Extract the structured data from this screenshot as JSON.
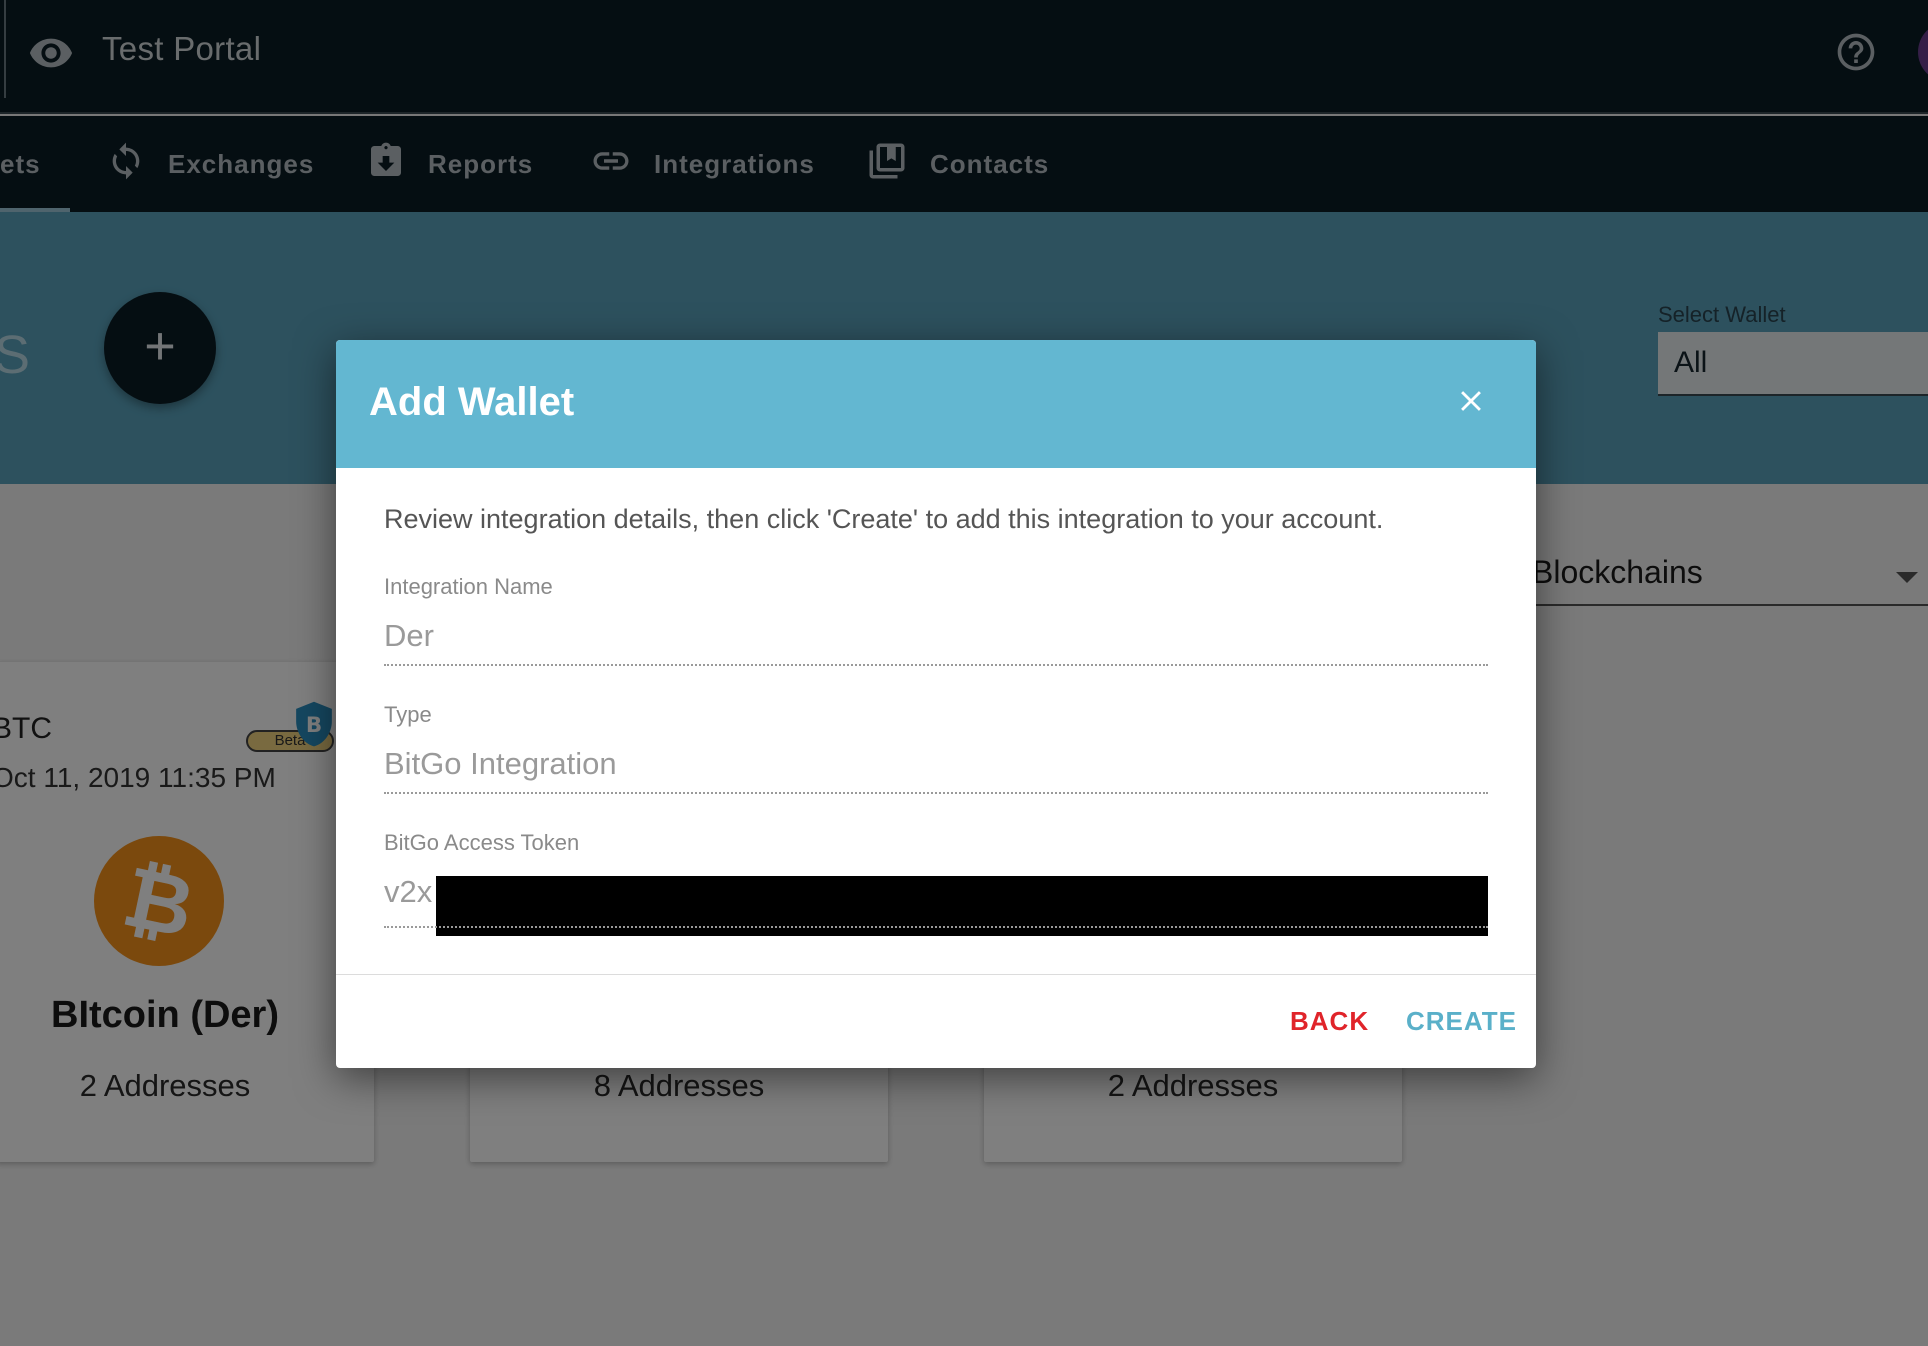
{
  "app": {
    "title": "Test Portal"
  },
  "nav": {
    "tabs": [
      {
        "label": "ets"
      },
      {
        "label": "Exchanges"
      },
      {
        "label": "Reports"
      },
      {
        "label": "Integrations"
      },
      {
        "label": "Contacts"
      }
    ]
  },
  "band": {
    "partial_title": "S",
    "add_label": "+",
    "select_wallet_label": "Select Wallet",
    "select_wallet_value": "All"
  },
  "content": {
    "blockchain_filter": "Blockchains",
    "cards": [
      {
        "code": "BTC",
        "date": "Oct 11, 2019 11:35 PM",
        "name": "BItcoin (Der)",
        "addresses": "2 Addresses"
      },
      {
        "addresses": "8 Addresses"
      },
      {
        "addresses": "2 Addresses"
      }
    ],
    "beta_label": "Beta",
    "coin_symbol": "B"
  },
  "modal": {
    "title": "Add Wallet",
    "intro": "Review integration details, then click 'Create' to add this integration to your account.",
    "fields": [
      {
        "label": "Integration Name",
        "value": "Der"
      },
      {
        "label": "Type",
        "value": "BitGo Integration"
      },
      {
        "label": "BitGo Access Token",
        "value": "v2x"
      }
    ],
    "back_label": "BACK",
    "create_label": "CREATE"
  },
  "colors": {
    "topbar": "#0b1c24",
    "accent": "#63b7d1",
    "back": "#e0242a",
    "create": "#5ab0c9"
  }
}
